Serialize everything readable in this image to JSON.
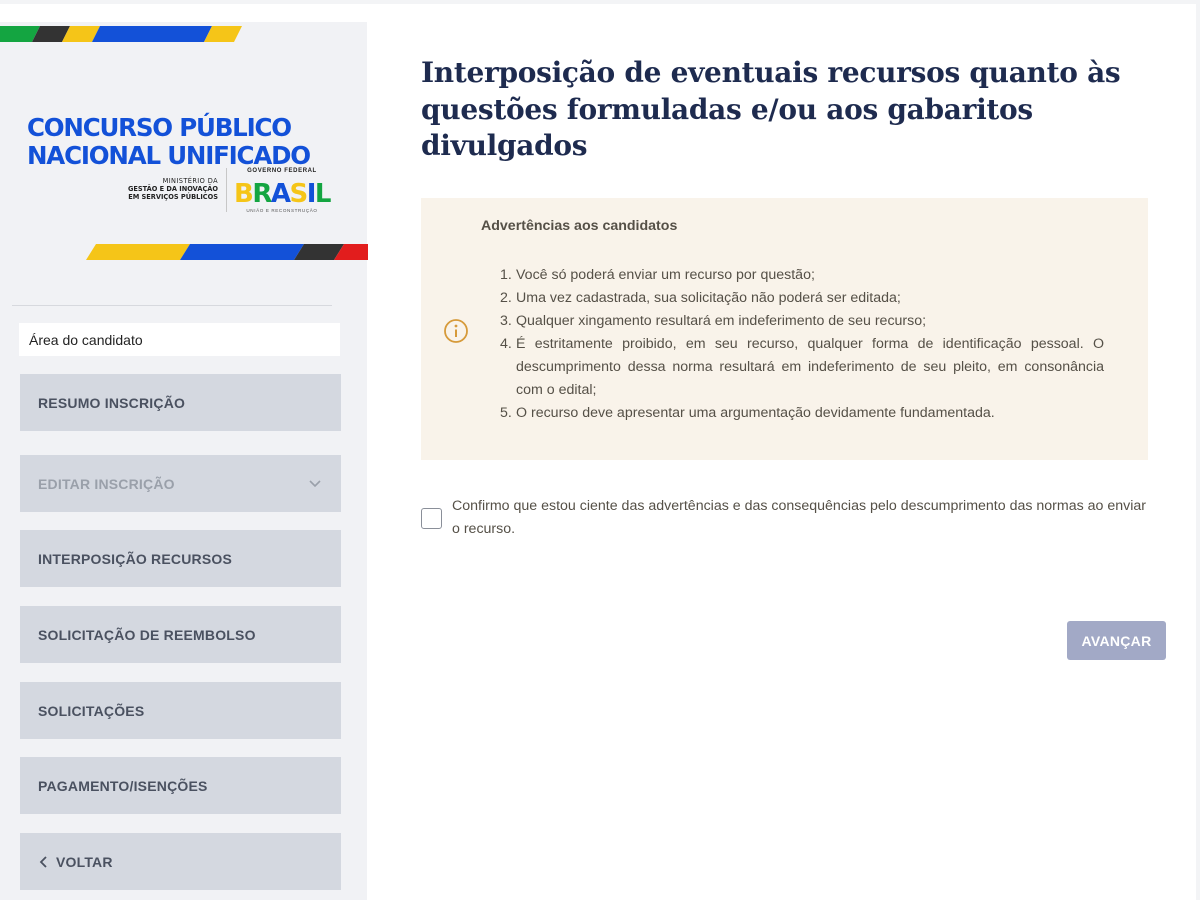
{
  "brand": {
    "title_line1": "CONCURSO PÚBLICO",
    "title_line2": "NACIONAL UNIFICADO",
    "ministry_line1": "MINISTÉRIO DA",
    "ministry_line2": "GESTÃO E DA INOVAÇÃO",
    "ministry_line3": "EM SERVIÇOS PÚBLICOS",
    "gov_top": "GOVERNO FEDERAL",
    "gov_logo": "BRASIL",
    "gov_slogan": "UNIÃO E RECONSTRUÇÃO",
    "colors": {
      "blue": "#1351d8",
      "green": "#14a541",
      "yellow": "#f5c518",
      "red": "#e21d1d",
      "dark": "#333333"
    }
  },
  "sidebar": {
    "area_label": "Área do candidato",
    "items": [
      {
        "label": "RESUMO INSCRIÇÃO",
        "disabled": false
      },
      {
        "label": "EDITAR INSCRIÇÃO",
        "disabled": true,
        "icon": "chevron-down-icon"
      },
      {
        "label": "INTERPOSIÇÃO RECURSOS",
        "disabled": false
      },
      {
        "label": "SOLICITAÇÃO DE REEMBOLSO",
        "disabled": false
      },
      {
        "label": "SOLICITAÇÕES",
        "disabled": false
      },
      {
        "label": "PAGAMENTO/ISENÇÕES",
        "disabled": false
      }
    ],
    "back_label": "VOLTAR",
    "back_icon": "chevron-left-icon"
  },
  "main": {
    "title": "Interposição de eventuais recursos quanto às questões formuladas e/ou aos gabaritos divulgados",
    "warnings": {
      "title": "Advertências aos candidatos",
      "icon": "info-icon",
      "items": [
        {
          "num": "1.",
          "text": "Você só poderá enviar um recurso por questão;"
        },
        {
          "num": "2.",
          "text": "Uma vez cadastrada, sua solicitação não poderá ser editada;"
        },
        {
          "num": "3.",
          "text": "Qualquer xingamento resultará em indeferimento de seu recurso;"
        },
        {
          "num": "4.",
          "text": "É estritamente proibido, em seu recurso, qualquer forma de identificação pessoal. O descumprimento dessa norma resultará em indeferimento de seu pleito, em consonância com o edital;"
        },
        {
          "num": "5.",
          "text": "O recurso deve apresentar uma argumentação devidamente fundamentada."
        }
      ]
    },
    "confirm_text": "Confirmo que estou ciente das advertências e das consequências pelo descumprimento das normas ao enviar o recurso.",
    "confirm_checked": false,
    "advance_label": "AVANÇAR"
  }
}
